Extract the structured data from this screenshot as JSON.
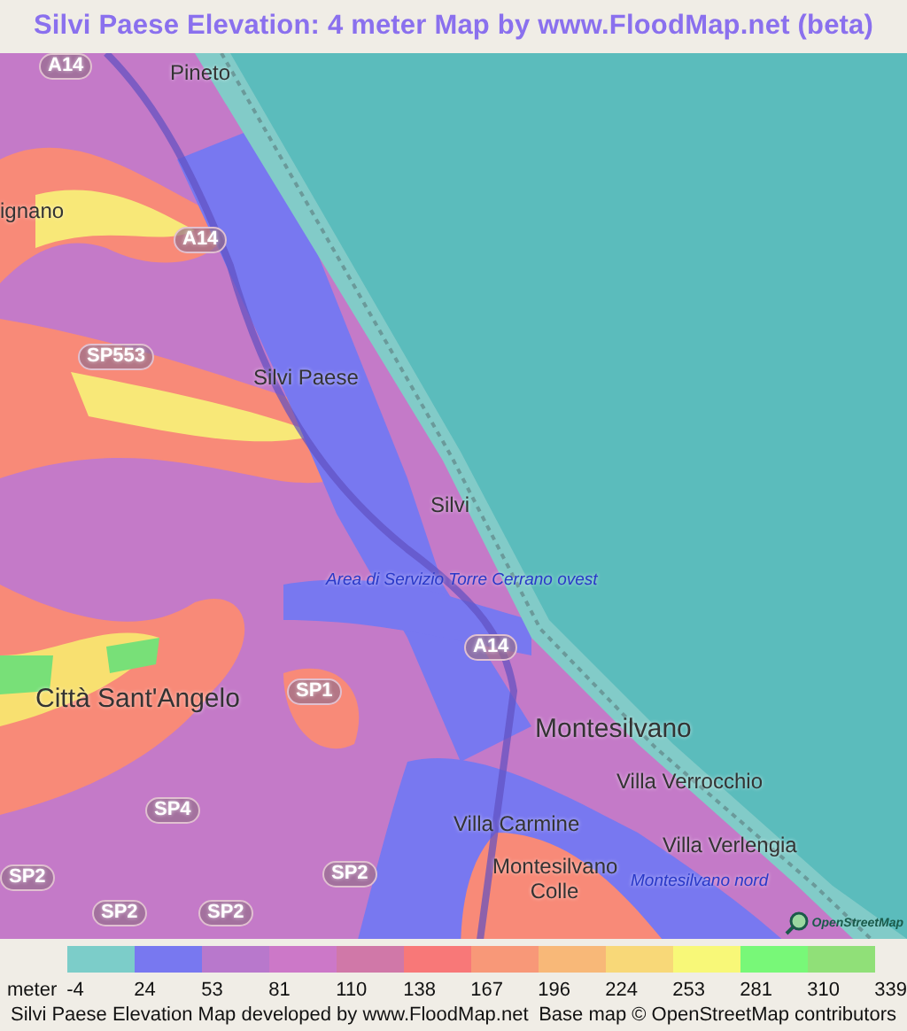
{
  "title": "Silvi Paese Elevation: 4 meter Map by www.FloodMap.net (beta)",
  "map": {
    "labels": [
      {
        "kind": "road",
        "text": "A14"
      },
      {
        "kind": "place",
        "text": "Pineto"
      },
      {
        "kind": "place",
        "text": "ignano"
      },
      {
        "kind": "road",
        "text": "A14"
      },
      {
        "kind": "road",
        "text": "SP553"
      },
      {
        "kind": "place",
        "text": "Silvi Paese"
      },
      {
        "kind": "place",
        "text": "Silvi"
      },
      {
        "kind": "service",
        "text": "Area di Servizio Torre Cerrano ovest"
      },
      {
        "kind": "road",
        "text": "A14"
      },
      {
        "kind": "place",
        "text": "Città Sant'Angelo"
      },
      {
        "kind": "road",
        "text": "SP1"
      },
      {
        "kind": "road",
        "text": "SP4"
      },
      {
        "kind": "place",
        "text": "Montesilvano"
      },
      {
        "kind": "place",
        "text": "Villa Verrocchio"
      },
      {
        "kind": "place",
        "text": "Villa Carmine"
      },
      {
        "kind": "place",
        "text": "Villa Verlengia"
      },
      {
        "kind": "road",
        "text": "SP2"
      },
      {
        "kind": "road",
        "text": "SP2"
      },
      {
        "kind": "place",
        "text": "Montesilvano Colle"
      },
      {
        "kind": "service",
        "text": "Montesilvano nord"
      },
      {
        "kind": "road",
        "text": "SP2"
      },
      {
        "kind": "road",
        "text": "SP2"
      }
    ],
    "logo": "OpenStreetMap"
  },
  "legend": {
    "unit": "meter",
    "swatches": [
      {
        "label": "-4",
        "color": "#7ccdc9"
      },
      {
        "label": "24",
        "color": "#7878f0"
      },
      {
        "label": "53",
        "color": "#b878cc"
      },
      {
        "label": "81",
        "color": "#cc78c8"
      },
      {
        "label": "110",
        "color": "#d078a8"
      },
      {
        "label": "138",
        "color": "#f87878"
      },
      {
        "label": "167",
        "color": "#f89878"
      },
      {
        "label": "196",
        "color": "#f8b878"
      },
      {
        "label": "224",
        "color": "#f8d878"
      },
      {
        "label": "253",
        "color": "#f8f878"
      },
      {
        "label": "281",
        "color": "#78f878"
      },
      {
        "label": "310",
        "color": "#90e078"
      }
    ],
    "last_label": "339"
  },
  "footer": {
    "left": "Silvi Paese Elevation Map developed by www.FloodMap.net",
    "right": "Base map © OpenStreetMap contributors"
  }
}
